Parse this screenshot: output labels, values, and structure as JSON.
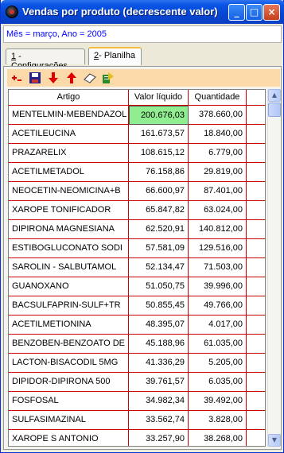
{
  "window": {
    "title": "Vendas por produto (decrescente valor)",
    "minimize_glyph": "_",
    "maximize_glyph": "□",
    "close_glyph": "×"
  },
  "info": {
    "text": "Mês = março,  Ano = 2005"
  },
  "tabs": [
    {
      "hotkey": "1",
      "label": " - Configurações"
    },
    {
      "hotkey": "2",
      "label": "- Planilha"
    }
  ],
  "toolbar": {
    "icons": [
      "add-row-icon",
      "save-icon",
      "sort-descending-icon",
      "sort-ascending-icon",
      "eraser-icon",
      "export-icon"
    ]
  },
  "table": {
    "columns": [
      "Artigo",
      "Valor líquido",
      "Quantidade"
    ],
    "rows": [
      [
        "MENTELMIN-MEBENDAZOL",
        "200.676,03",
        "378.660,00"
      ],
      [
        "ACETILEUCINA",
        "161.673,57",
        "18.840,00"
      ],
      [
        "PRAZARELIX",
        "108.615,12",
        "6.779,00"
      ],
      [
        "ACETILMETADOL",
        "76.158,86",
        "29.819,00"
      ],
      [
        "NEOCETIN-NEOMICINA+B",
        "66.600,97",
        "87.401,00"
      ],
      [
        "XAROPE TONIFICADOR",
        "65.847,82",
        "63.024,00"
      ],
      [
        "DIPIRONA MAGNESIANA",
        "62.520,91",
        "140.812,00"
      ],
      [
        "ESTIBOGLUCONATO SODI",
        "57.581,09",
        "129.516,00"
      ],
      [
        "SAROLIN - SALBUTAMOL",
        "52.134,47",
        "71.503,00"
      ],
      [
        "GUANOXANO",
        "51.050,75",
        "39.996,00"
      ],
      [
        "BACSULFAPRIN-SULF+TR",
        "50.855,45",
        "49.766,00"
      ],
      [
        "ACETILMETIONINA",
        "48.395,07",
        "4.017,00"
      ],
      [
        "BENZOBEN-BENZOATO DE",
        "45.188,96",
        "61.035,00"
      ],
      [
        "LACTON-BISACODIL 5MG",
        "41.336,29",
        "5.205,00"
      ],
      [
        "DIPIDOR-DIPIRONA 500",
        "39.761,57",
        "6.035,00"
      ],
      [
        "FOSFOSAL",
        "34.982,34",
        "39.492,00"
      ],
      [
        "SULFASIMAZINAL",
        "33.562,74",
        "3.828,00"
      ],
      [
        "XAROPE S ANTONIO",
        "33.257,90",
        "38.268,00"
      ]
    ]
  },
  "scrollbar": {
    "up_glyph": "▲",
    "down_glyph": "▼"
  }
}
